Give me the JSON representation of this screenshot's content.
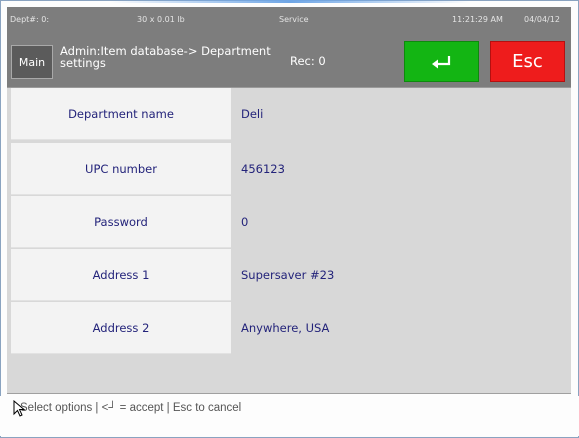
{
  "status_bar": {
    "dept": "Dept#: 0:",
    "weight": "30 x 0.01 lb",
    "mode": "Service",
    "time": "11:21:29 AM",
    "date": "04/04/12"
  },
  "header": {
    "main_label": "Main",
    "title_line1": "Admin:Item database-> Department",
    "title_line2": "settings",
    "rec": "Rec: 0",
    "enter_icon": "enter-return-icon",
    "esc_label": "Esc",
    "enter_color": "#13b513",
    "esc_color": "#ee1c1c"
  },
  "fields": [
    {
      "label": "Department name",
      "value": "Deli"
    },
    {
      "label": "UPC number",
      "value": "456123"
    },
    {
      "label": "Password",
      "value": "0"
    },
    {
      "label": "Address 1",
      "value": "Supersaver #23"
    },
    {
      "label": "Address 2",
      "value": "Anywhere, USA"
    }
  ],
  "footer": {
    "text": "Select options | <┘ = accept | Esc to cancel"
  }
}
